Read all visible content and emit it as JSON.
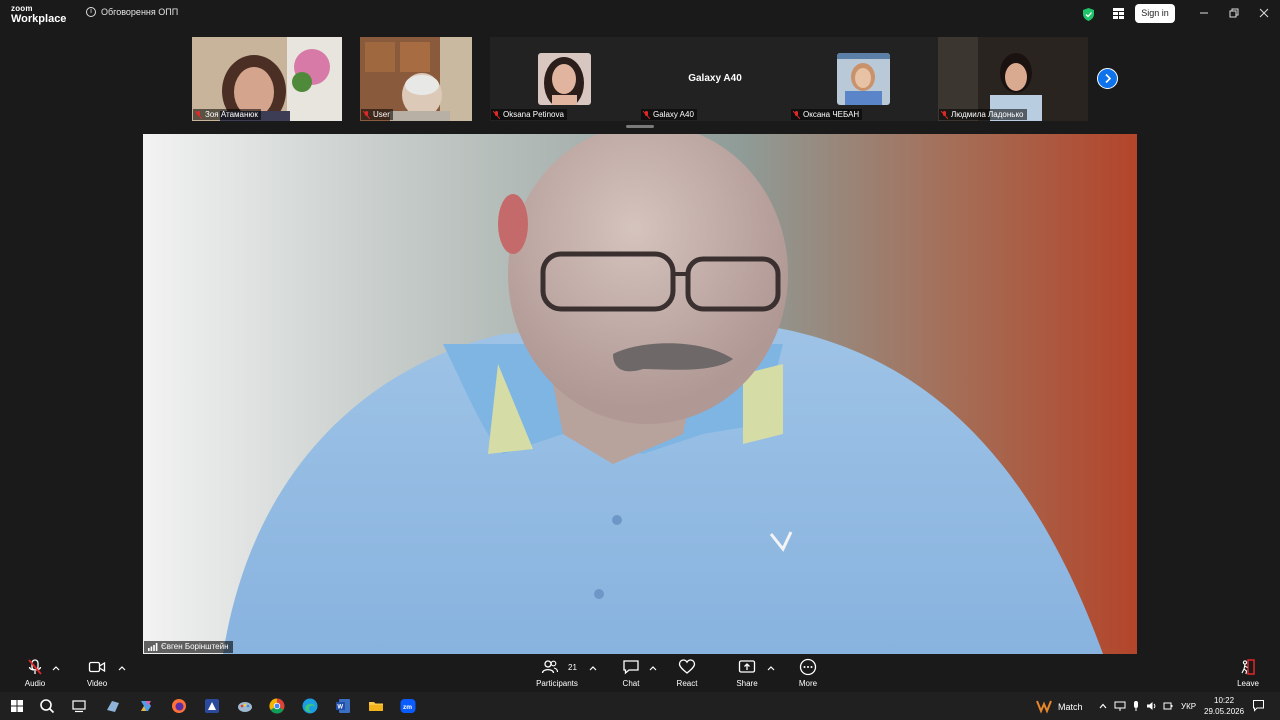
{
  "app": {
    "logo_line1": "zoom",
    "logo_line2": "Workplace",
    "meeting_title": "Обговорення ОПП",
    "signin_label": "Sign in"
  },
  "participants_strip": {
    "tiles": [
      {
        "name": "Зоя Атаманюк",
        "type": "video"
      },
      {
        "name": "User",
        "type": "video"
      },
      {
        "name": "Oksana Petinova",
        "type": "avatar"
      },
      {
        "name": "Galaxy A40",
        "type": "text",
        "display_text": "Galaxy A40"
      },
      {
        "name": "Оксана ЧЕБАН",
        "type": "avatar"
      },
      {
        "name": "Людмила Ладонько",
        "type": "video"
      }
    ]
  },
  "main_speaker": {
    "name": "Євген Борінштейн"
  },
  "toolbar": {
    "audio_label": "Audio",
    "video_label": "Video",
    "participants_label": "Participants",
    "participants_count": "21",
    "chat_label": "Chat",
    "react_label": "React",
    "share_label": "Share",
    "more_label": "More",
    "leave_label": "Leave"
  },
  "taskbar": {
    "weather_label": "Match",
    "language": "УКР",
    "time": "10:22",
    "date": "29.05.2026"
  },
  "colors": {
    "accent": "#0e72ed",
    "mute_red": "#e02828",
    "shield_green": "#1fc46a",
    "background": "#1a1a1a"
  }
}
